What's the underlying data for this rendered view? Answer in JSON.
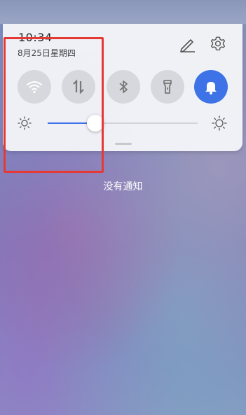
{
  "status": {
    "time": "10:34",
    "date": "8月25日星期四"
  },
  "header": {
    "edit_icon": "pencil-icon",
    "settings_icon": "gear-icon"
  },
  "tiles": [
    {
      "name": "wifi",
      "icon": "wifi-icon",
      "active": false
    },
    {
      "name": "mobile-data",
      "icon": "data-arrows-icon",
      "active": false
    },
    {
      "name": "bluetooth",
      "icon": "bluetooth-icon",
      "active": false
    },
    {
      "name": "flashlight",
      "icon": "flashlight-icon",
      "active": false
    },
    {
      "name": "sound",
      "icon": "bell-icon",
      "active": true
    }
  ],
  "brightness": {
    "level": 0.32
  },
  "notifications": {
    "empty_text": "没有通知"
  },
  "colors": {
    "accent": "#3d73e6",
    "highlight": "#e53935"
  }
}
